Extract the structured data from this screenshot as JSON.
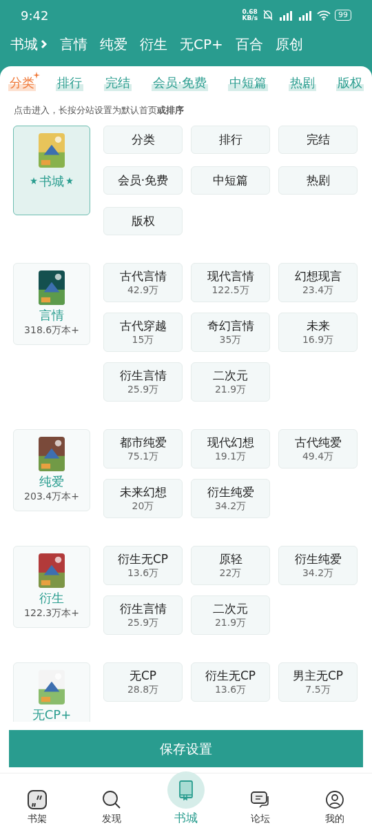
{
  "status_bar": {
    "time": "9:42",
    "speed": "0.68",
    "speed_unit": "KB/s",
    "battery": "99"
  },
  "breadcrumb": {
    "root": "书城",
    "items": [
      "言情",
      "纯爱",
      "衍生",
      "无CP+",
      "百合",
      "原创"
    ]
  },
  "tabs": [
    {
      "label": "分类",
      "selected": true
    },
    {
      "label": "排行",
      "selected": false
    },
    {
      "label": "完结",
      "selected": false
    },
    {
      "label": "会员·免费",
      "selected": false
    },
    {
      "label": "中短篇",
      "selected": false
    },
    {
      "label": "热剧",
      "selected": false
    },
    {
      "label": "版权",
      "selected": false
    }
  ],
  "hint": "点击进入，长按分站设置为默认首页**或排序**",
  "sections": [
    {
      "title": "书城",
      "kind": "home",
      "selected": true,
      "tiles": [
        {
          "label": "分类"
        },
        {
          "label": "排行"
        },
        {
          "label": "完结"
        },
        {
          "label": "会员·免费"
        },
        {
          "label": "中短篇"
        },
        {
          "label": "热剧"
        },
        {
          "label": "版权"
        }
      ]
    },
    {
      "title": "言情",
      "count": "318.6万本+",
      "kind": "site",
      "selected": false,
      "tiles": [
        {
          "label": "古代言情",
          "count": "42.9万"
        },
        {
          "label": "现代言情",
          "count": "122.5万"
        },
        {
          "label": "幻想现言",
          "count": "23.4万"
        },
        {
          "label": "古代穿越",
          "count": "15万"
        },
        {
          "label": "奇幻言情",
          "count": "35万"
        },
        {
          "label": "未来",
          "count": "16.9万"
        },
        {
          "label": "衍生言情",
          "count": "25.9万"
        },
        {
          "label": "二次元",
          "count": "21.9万"
        }
      ]
    },
    {
      "title": "纯爱",
      "count": "203.4万本+",
      "kind": "site",
      "selected": false,
      "tiles": [
        {
          "label": "都市纯爱",
          "count": "75.1万"
        },
        {
          "label": "现代幻想",
          "count": "19.1万"
        },
        {
          "label": "古代纯爱",
          "count": "49.4万"
        },
        {
          "label": "未来幻想",
          "count": "20万"
        },
        {
          "label": "衍生纯爱",
          "count": "34.2万"
        }
      ]
    },
    {
      "title": "衍生",
      "count": "122.3万本+",
      "kind": "site",
      "selected": false,
      "tiles": [
        {
          "label": "衍生无CP",
          "count": "13.6万"
        },
        {
          "label": "原轻",
          "count": "22万"
        },
        {
          "label": "衍生纯爱",
          "count": "34.2万"
        },
        {
          "label": "衍生言情",
          "count": "25.9万"
        },
        {
          "label": "二次元",
          "count": "21.9万"
        }
      ]
    },
    {
      "title": "无CP+",
      "kind": "site",
      "selected": false,
      "tiles": [
        {
          "label": "无CP",
          "count": "28.8万"
        },
        {
          "label": "衍生无CP",
          "count": "13.6万"
        },
        {
          "label": "男主无CP",
          "count": "7.5万"
        }
      ]
    }
  ],
  "save_button": "保存设置",
  "nav": [
    {
      "label": "书架",
      "kind": "shelf",
      "selected": false
    },
    {
      "label": "发现",
      "kind": "discover",
      "selected": false
    },
    {
      "label": "书城",
      "kind": "store",
      "selected": true
    },
    {
      "label": "论坛",
      "kind": "forum",
      "selected": false
    },
    {
      "label": "我的",
      "kind": "me",
      "selected": false
    }
  ]
}
